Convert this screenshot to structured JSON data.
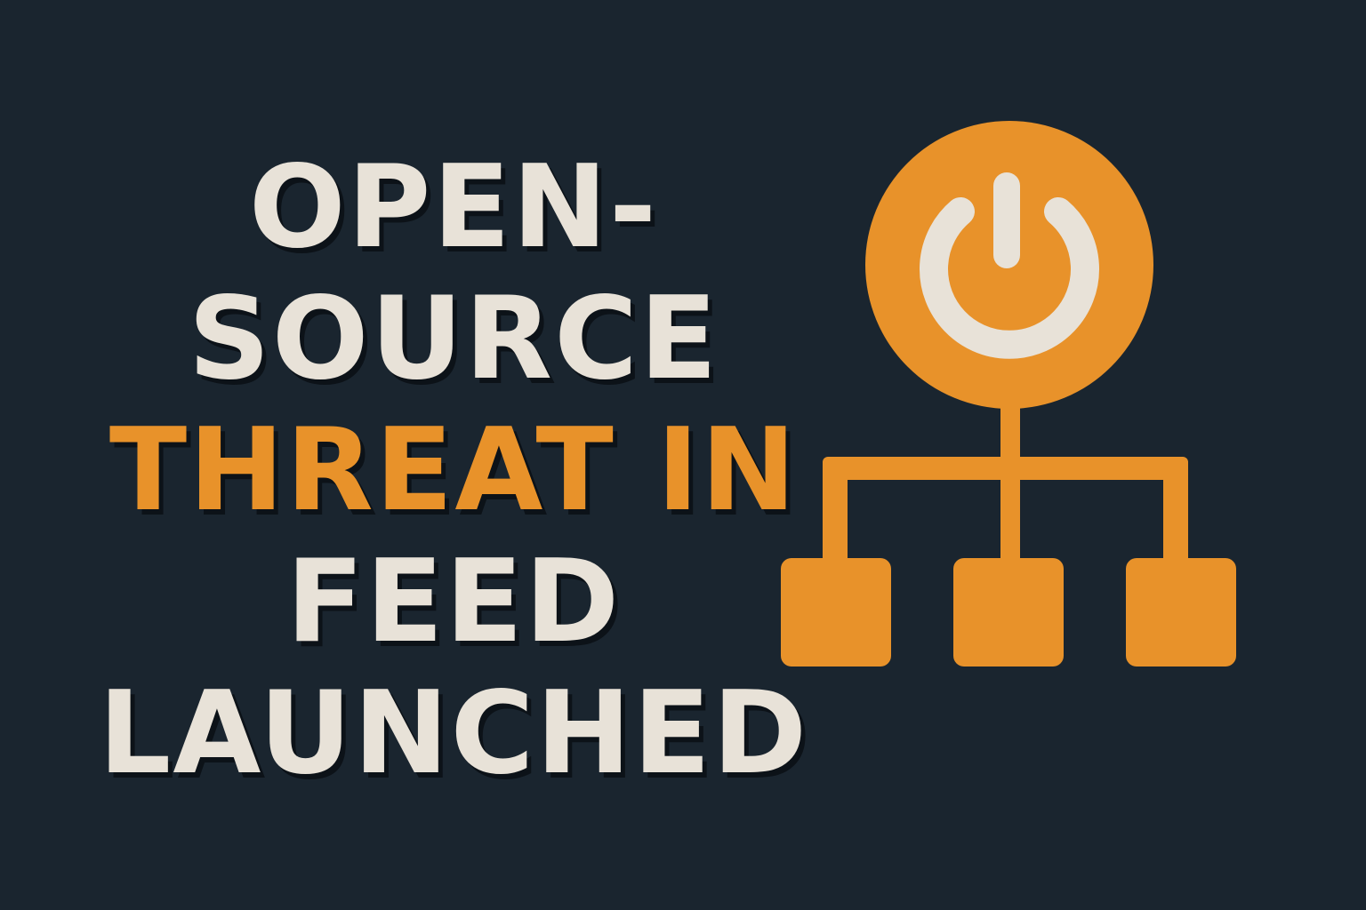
{
  "headline": {
    "line1": "OPEN-",
    "line2": "SOURCE",
    "line3": "THREAT IN",
    "line4": "FEED",
    "line5": "LAUNCHED"
  },
  "colors": {
    "background": "#1a252f",
    "text_light": "#e8e2d8",
    "accent": "#e8922a"
  },
  "icons": {
    "main": "power-network-icon",
    "power": "power-icon",
    "node_count": 3
  }
}
